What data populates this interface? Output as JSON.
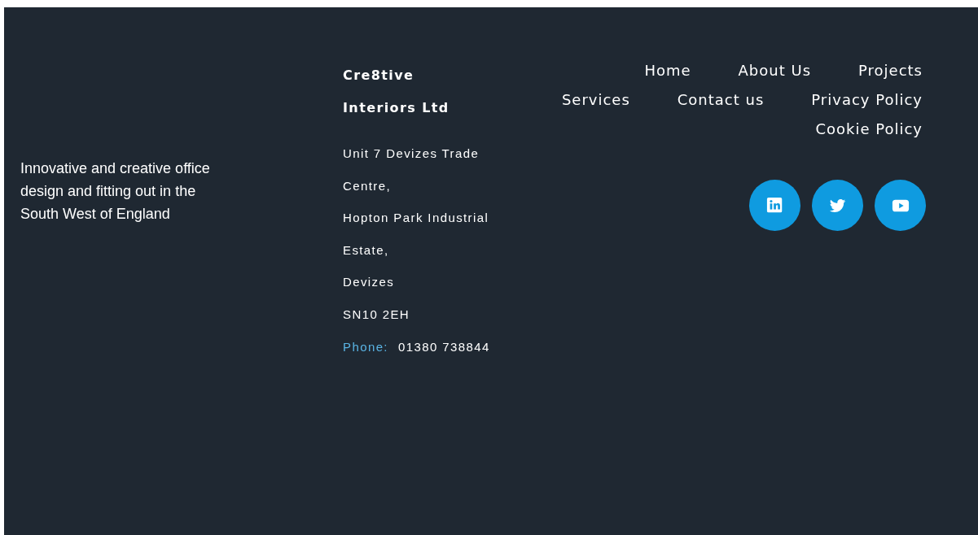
{
  "tagline": "Innovative and creative office design and fitting out in the South West of England",
  "company": {
    "name": "Cre8tive Interiors Ltd",
    "address": [
      "Unit 7 Devizes Trade Centre,",
      "Hopton Park Industrial Estate,",
      "Devizes",
      "SN10 2EH"
    ],
    "phone_label": "Phone:",
    "phone": "01380 738844"
  },
  "nav": [
    "Home",
    "About Us",
    "Projects",
    "Services",
    "Contact us",
    "Privacy Policy",
    "Cookie Policy"
  ],
  "social": [
    {
      "kind": "linkedin"
    },
    {
      "kind": "twitter"
    },
    {
      "kind": "youtube"
    }
  ]
}
